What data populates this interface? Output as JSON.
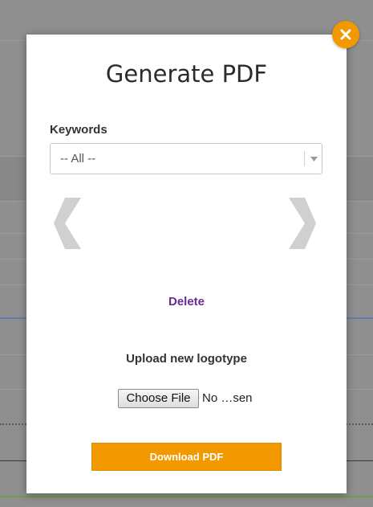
{
  "modal": {
    "title": "Generate PDF",
    "keywords": {
      "label": "Keywords",
      "selected": "-- All --"
    },
    "delete_label": "Delete",
    "upload": {
      "label": "Upload new logotype",
      "button_label": "Choose File",
      "status": "No …sen"
    },
    "download_label": "Download PDF"
  },
  "colors": {
    "accent": "#f29900",
    "delete_link": "#6a2c91"
  },
  "icons": {
    "close": "close-icon",
    "prev": "chevron-left-icon",
    "next": "chevron-right-icon",
    "select_arrow": "caret-down-icon"
  }
}
